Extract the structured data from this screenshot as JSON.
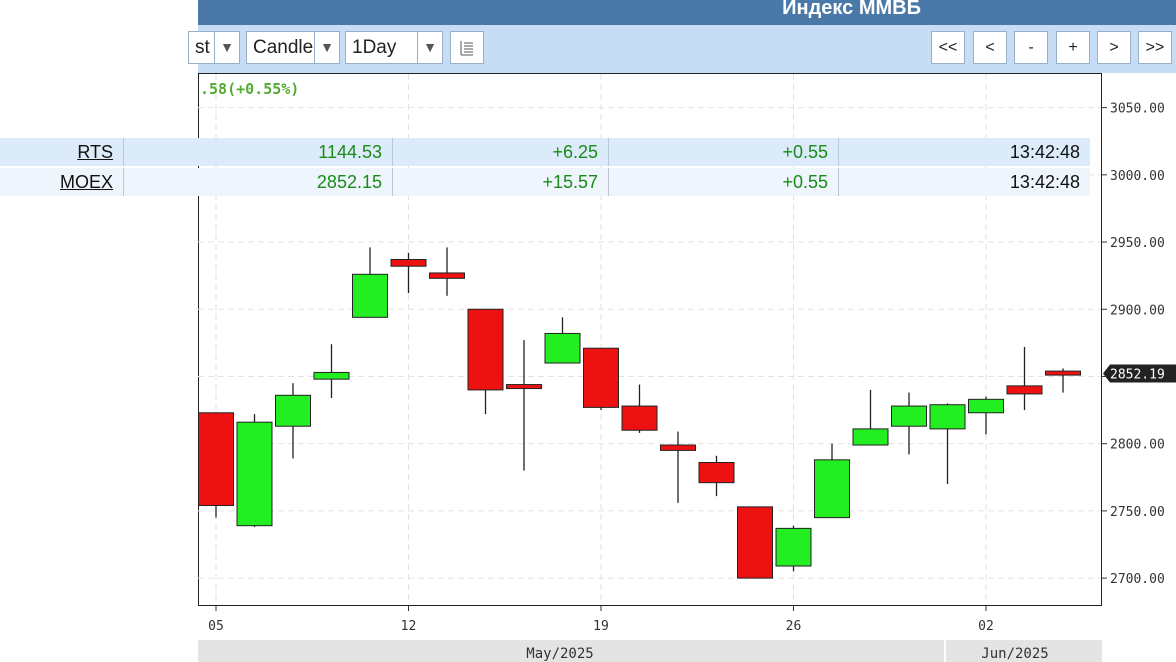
{
  "header": {
    "title": "Индекс ММВБ"
  },
  "toolbar": {
    "series_select": "st",
    "chart_type_select": "Candle",
    "period_select": "1Day",
    "dropdown_arrow": "▼",
    "nav_buttons": [
      "<<",
      "<",
      "-",
      "+",
      ">",
      ">>"
    ]
  },
  "change_text": ".58(+0.55%)",
  "quotes": [
    {
      "name": "RTS",
      "last": "1144.53",
      "change": "+6.25",
      "change_pct": "+0.55",
      "time": "13:42:48"
    },
    {
      "name": "MOEX",
      "last": "2852.15",
      "change": "+15.57",
      "change_pct": "+0.55",
      "time": "13:42:48"
    }
  ],
  "colors": {
    "up": "#22ee22",
    "down": "#ee1111",
    "toolbar_bg": "#c6ddf5",
    "title_bg": "#4a78a8",
    "change_text": "#55aa33"
  },
  "chart_data": {
    "type": "candlestick",
    "title": "Индекс ММВБ",
    "ylim": [
      2680,
      3075
    ],
    "y_ticks": [
      "2700.00",
      "2750.00",
      "2800.00",
      "2850.00",
      "2900.00",
      "2950.00",
      "3000.00",
      "3050.00"
    ],
    "x_ticks": [
      "05",
      "12",
      "19",
      "26",
      "02"
    ],
    "month_labels": [
      "May/2025",
      "Jun/2025"
    ],
    "last_price_label": "2852.19",
    "grid": true,
    "candles": [
      {
        "open": 2823,
        "high": 2823,
        "low": 2745,
        "close": 2754
      },
      {
        "open": 2739,
        "high": 2822,
        "low": 2738,
        "close": 2816
      },
      {
        "open": 2813,
        "high": 2845,
        "low": 2789,
        "close": 2836
      },
      {
        "open": 2848,
        "high": 2874,
        "low": 2834,
        "close": 2853
      },
      {
        "open": 2894,
        "high": 2946,
        "low": 2894,
        "close": 2926
      },
      {
        "open": 2937,
        "high": 2942,
        "low": 2912,
        "close": 2932
      },
      {
        "open": 2927,
        "high": 2946,
        "low": 2910,
        "close": 2923
      },
      {
        "open": 2900,
        "high": 2900,
        "low": 2822,
        "close": 2840
      },
      {
        "open": 2843,
        "high": 2877,
        "low": 2780,
        "close": 2842
      },
      {
        "open": 2860,
        "high": 2894,
        "low": 2860,
        "close": 2882
      },
      {
        "open": 2871,
        "high": 2871,
        "low": 2825,
        "close": 2827
      },
      {
        "open": 2828,
        "high": 2844,
        "low": 2808,
        "close": 2810
      },
      {
        "open": 2799,
        "high": 2809,
        "low": 2756,
        "close": 2795
      },
      {
        "open": 2786,
        "high": 2791,
        "low": 2761,
        "close": 2771
      },
      {
        "open": 2753,
        "high": 2753,
        "low": 2700,
        "close": 2700
      },
      {
        "open": 2709,
        "high": 2739,
        "low": 2705,
        "close": 2737
      },
      {
        "open": 2745,
        "high": 2800,
        "low": 2745,
        "close": 2788
      },
      {
        "open": 2799,
        "high": 2840,
        "low": 2799,
        "close": 2811
      },
      {
        "open": 2813,
        "high": 2838,
        "low": 2792,
        "close": 2828
      },
      {
        "open": 2811,
        "high": 2830,
        "low": 2770,
        "close": 2829
      },
      {
        "open": 2823,
        "high": 2835,
        "low": 2807,
        "close": 2833
      },
      {
        "open": 2843,
        "high": 2872,
        "low": 2825,
        "close": 2837
      },
      {
        "open": 2853,
        "high": 2856,
        "low": 2838,
        "close": 2852
      }
    ]
  }
}
